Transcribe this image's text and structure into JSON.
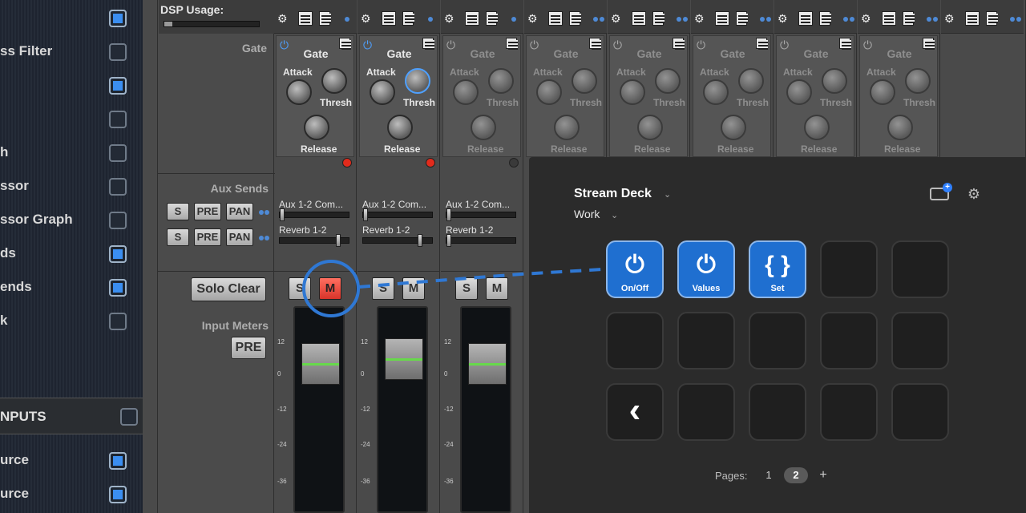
{
  "sidebar": {
    "items": [
      {
        "label": "",
        "checked": true
      },
      {
        "label": "ss Filter",
        "checked": false
      },
      {
        "label": "",
        "checked": true
      },
      {
        "label": "",
        "checked": false
      },
      {
        "label": "h",
        "checked": false
      },
      {
        "label": "ssor",
        "checked": false
      },
      {
        "label": "ssor Graph",
        "checked": false
      },
      {
        "label": "ds",
        "checked": true
      },
      {
        "label": "ends",
        "checked": true
      },
      {
        "label": "k",
        "checked": false
      }
    ],
    "inputs_header": "NPUTS",
    "sources": [
      {
        "label": "urce",
        "checked": true
      },
      {
        "label": "urce",
        "checked": true
      }
    ]
  },
  "mixer": {
    "dsp_label": "DSP Usage:",
    "gate_section_label": "Gate",
    "aux_sends_label": "Aux Sends",
    "solo_clear_label": "Solo Clear",
    "input_meters_label": "Input Meters",
    "pre_label": "PRE",
    "aux_rows": [
      {
        "s": "S",
        "pre": "PRE",
        "pan": "PAN"
      },
      {
        "s": "S",
        "pre": "PRE",
        "pan": "PAN"
      }
    ],
    "gate": {
      "title": "Gate",
      "attack": "Attack",
      "thresh": "Thresh",
      "release": "Release"
    },
    "aux_send_1": "Aux 1-2 Com...",
    "aux_send_2": "Reverb 1-2",
    "solo": "S",
    "mute": "M",
    "scale_marks": [
      "12",
      "0",
      "-12",
      "-24",
      "-36"
    ]
  },
  "stream_deck": {
    "device": "Stream Deck",
    "profile": "Work",
    "keys": [
      {
        "label": "On/Off",
        "icon": "⏻",
        "active": true
      },
      {
        "label": "Values",
        "icon": "⏻",
        "active": true
      },
      {
        "label": "Set",
        "icon": "{ }",
        "active": true
      }
    ],
    "back_icon": "‹",
    "pages_label": "Pages:",
    "pages": [
      "1",
      "2"
    ],
    "current_page": "2",
    "add_page": "+"
  },
  "colors": {
    "accent_blue": "#1f6fd0",
    "mute_red": "#e0443a",
    "highlight_circle": "#2f78d4"
  }
}
